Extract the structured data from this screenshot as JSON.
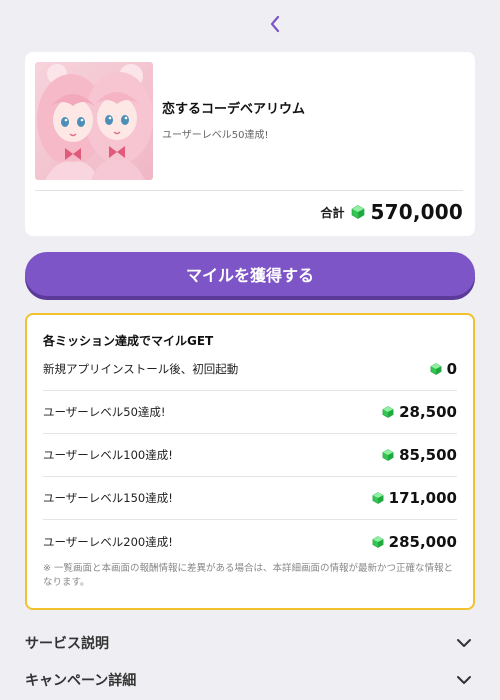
{
  "nav": {
    "back_icon": "chevron-left-icon",
    "accent": "#7d55c7"
  },
  "offer": {
    "title": "恋するコーデベアリウム",
    "subtitle": "ユーザーレベル50達成!",
    "total_label": "合計",
    "total_value": "570,000"
  },
  "cta": {
    "label": "マイルを獲得する",
    "color": "#7d55c7"
  },
  "missions": {
    "heading": "各ミッション達成でマイルGET",
    "items": [
      {
        "label": "新規アプリインストール後、初回起動",
        "value": "0"
      },
      {
        "label": "ユーザーレベル50達成!",
        "value": "28,500"
      },
      {
        "label": "ユーザーレベル100達成!",
        "value": "85,500"
      },
      {
        "label": "ユーザーレベル150達成!",
        "value": "171,000"
      },
      {
        "label": "ユーザーレベル200達成!",
        "value": "285,000"
      }
    ],
    "note": "※ 一覧画面と本画面の報酬情報に差異がある場合は、本詳細画面の情報が最新かつ正確な情報となります。",
    "border_color": "#f2c12e"
  },
  "accordions": [
    {
      "label": "サービス説明"
    },
    {
      "label": "キャンペーン詳細"
    }
  ]
}
